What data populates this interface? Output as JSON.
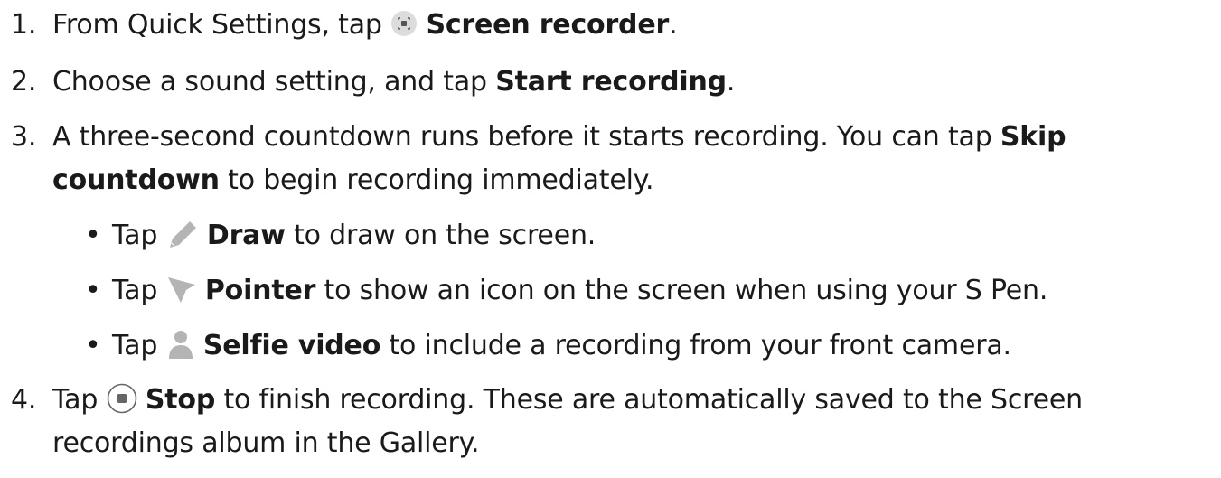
{
  "steps": [
    {
      "number": "1.",
      "text_before": "From Quick Settings, tap",
      "bold": "Screen recorder",
      "text_after": ".",
      "icon": "screen-recorder-icon"
    },
    {
      "number": "2.",
      "text_before": "Choose a sound setting, and tap",
      "bold": "Start recording",
      "text_after": "."
    },
    {
      "number": "3.",
      "line1_before": "A three-second countdown runs before it starts recording. You can tap",
      "line1_bold": "Skip",
      "line2_bold": "countdown",
      "line2_after": "to begin recording immediately.",
      "bullets": [
        {
          "bullet": "•",
          "tap": "Tap",
          "icon": "pencil-icon",
          "bold": "Draw",
          "text": "to draw on the screen."
        },
        {
          "bullet": "•",
          "tap": "Tap",
          "icon": "pointer-icon",
          "bold": "Pointer",
          "text": "to show an icon on the screen when using your S Pen."
        },
        {
          "bullet": "•",
          "tap": "Tap",
          "icon": "person-icon",
          "bold": "Selfie video",
          "text": "to include a recording from your front camera."
        }
      ]
    },
    {
      "number": "4.",
      "tap": "Tap",
      "icon": "stop-icon",
      "line1_bold": "Stop",
      "line1_after": "to finish recording. These are automatically saved to the Screen",
      "line2": "recordings album in the Gallery."
    }
  ]
}
